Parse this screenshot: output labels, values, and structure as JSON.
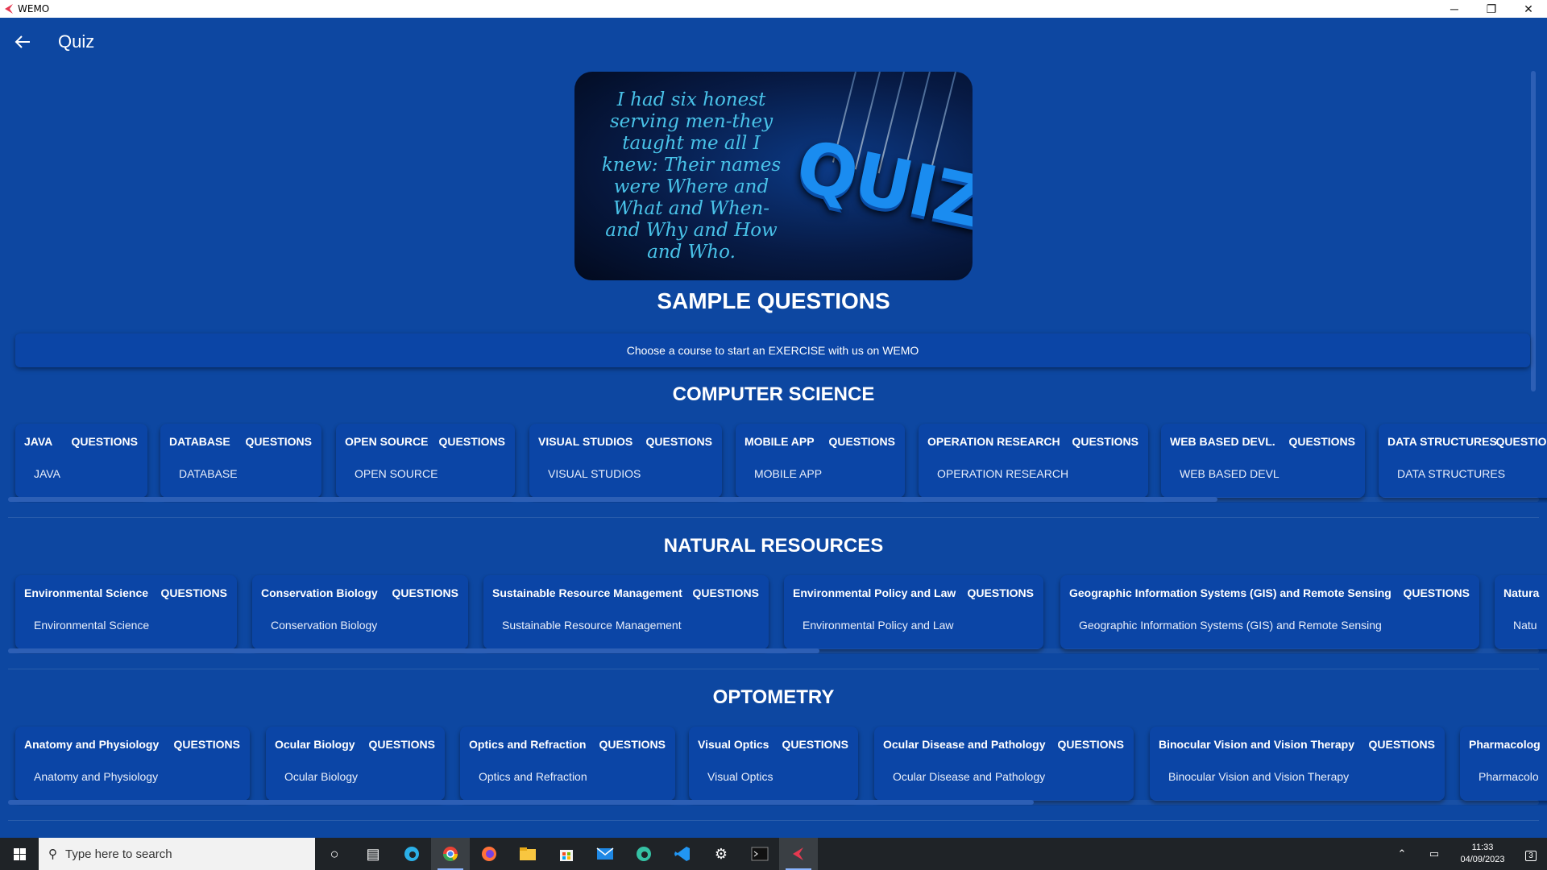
{
  "window": {
    "title": "WEMO",
    "controls": [
      "─",
      "❐",
      "✕"
    ]
  },
  "header": {
    "back_icon": "arrow-left-icon",
    "title": "Quiz"
  },
  "banner": {
    "quote": "I had six honest serving men-they taught me all I knew: Their names were Where and What and When- and Why and How and Who.",
    "word": "QUIZ"
  },
  "sample": {
    "heading": "SAMPLE QUESTIONS",
    "info": "Choose a course to start an EXERCISE with us on WEMO"
  },
  "sections": [
    {
      "heading": "COMPUTER SCIENCE",
      "scroll_thumb_fraction": 0.79,
      "cards": [
        {
          "title": "JAVA",
          "questions_label": "QUESTIONS",
          "subtitle": "JAVA"
        },
        {
          "title": "DATABASE",
          "questions_label": "QUESTIONS",
          "subtitle": "DATABASE"
        },
        {
          "title": "OPEN SOURCE",
          "questions_label": "QUESTIONS",
          "subtitle": "OPEN SOURCE"
        },
        {
          "title": "VISUAL STUDIOS",
          "questions_label": "QUESTIONS",
          "subtitle": "VISUAL STUDIOS"
        },
        {
          "title": "MOBILE APP",
          "questions_label": "QUESTIONS",
          "subtitle": "MOBILE APP"
        },
        {
          "title": "OPERATION RESEARCH",
          "questions_label": "QUESTIONS",
          "subtitle": "OPERATION RESEARCH"
        },
        {
          "title": "WEB BASED DEVL.",
          "questions_label": "QUESTIONS",
          "subtitle": "WEB BASED DEVL"
        },
        {
          "title": "DATA STRUCTURES",
          "questions_label": "QUESTIONS",
          "subtitle": "DATA STRUCTURES"
        }
      ]
    },
    {
      "heading": "NATURAL RESOURCES",
      "scroll_thumb_fraction": 0.53,
      "cards": [
        {
          "title": "Environmental Science",
          "questions_label": "QUESTIONS",
          "subtitle": "Environmental Science"
        },
        {
          "title": "Conservation Biology",
          "questions_label": "QUESTIONS",
          "subtitle": "Conservation Biology"
        },
        {
          "title": "Sustainable Resource Management",
          "questions_label": "QUESTIONS",
          "subtitle": "Sustainable Resource Management"
        },
        {
          "title": "Environmental Policy and Law",
          "questions_label": "QUESTIONS",
          "subtitle": "Environmental Policy and Law"
        },
        {
          "title": "Geographic Information Systems (GIS) and Remote Sensing",
          "questions_label": "QUESTIONS",
          "subtitle": "Geographic Information Systems (GIS) and Remote Sensing"
        },
        {
          "title": "Natura",
          "questions_label": "",
          "subtitle": "Natu"
        }
      ]
    },
    {
      "heading": "OPTOMETRY",
      "scroll_thumb_fraction": 0.67,
      "cards": [
        {
          "title": "Anatomy and Physiology",
          "questions_label": "QUESTIONS",
          "subtitle": "Anatomy and Physiology"
        },
        {
          "title": "Ocular Biology",
          "questions_label": "QUESTIONS",
          "subtitle": "Ocular Biology"
        },
        {
          "title": "Optics and Refraction",
          "questions_label": "QUESTIONS",
          "subtitle": "Optics and Refraction"
        },
        {
          "title": "Visual Optics",
          "questions_label": "QUESTIONS",
          "subtitle": "Visual Optics"
        },
        {
          "title": "Ocular Disease and Pathology",
          "questions_label": "QUESTIONS",
          "subtitle": "Ocular Disease and Pathology"
        },
        {
          "title": "Binocular Vision and Vision Therapy",
          "questions_label": "QUESTIONS",
          "subtitle": "Binocular Vision and Vision Therapy"
        },
        {
          "title": "Pharmacolog",
          "questions_label": "",
          "subtitle": "Pharmacolo"
        }
      ]
    }
  ],
  "taskbar": {
    "search_placeholder": "Type here to search",
    "apps": [
      "cortana-icon",
      "task-view-icon",
      "edge-icon",
      "chrome-icon",
      "firefox-icon",
      "file-explorer-icon",
      "store-icon",
      "mail-icon",
      "edge-dev-icon",
      "vscode-icon",
      "settings-icon",
      "terminal-icon",
      "wemo-icon"
    ],
    "time": "11:33",
    "date": "04/09/2023",
    "notification_count": "3"
  },
  "colors": {
    "background": "#0d47a1",
    "card": "#0b45a6",
    "taskbar": "#1f2327"
  }
}
